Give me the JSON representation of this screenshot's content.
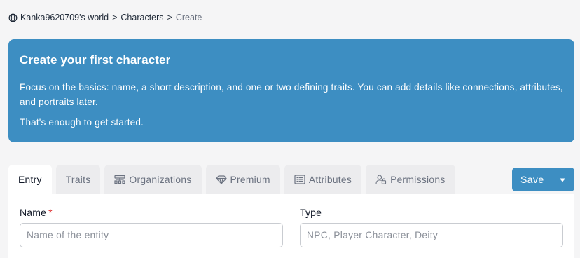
{
  "breadcrumb": {
    "world": "Kanka9620709's world",
    "separator": ">",
    "section": "Characters",
    "current": "Create"
  },
  "callout": {
    "title": "Create your first character",
    "body": "Focus on the basics: name, a short description, and one or two defining traits. You can add details like connections, attributes, and portraits later.",
    "footer": "That's enough to get started."
  },
  "tabs": [
    {
      "label": "Entry",
      "icon": "none",
      "active": true
    },
    {
      "label": "Traits",
      "icon": "none",
      "active": false
    },
    {
      "label": "Organizations",
      "icon": "organizations-icon",
      "active": false
    },
    {
      "label": "Premium",
      "icon": "gem-icon",
      "active": false
    },
    {
      "label": "Attributes",
      "icon": "list-icon",
      "active": false
    },
    {
      "label": "Permissions",
      "icon": "user-lock-icon",
      "active": false
    }
  ],
  "actions": {
    "save_label": "Save"
  },
  "form": {
    "name": {
      "label": "Name",
      "required_mark": "*",
      "placeholder": "Name of the entity",
      "value": ""
    },
    "type": {
      "label": "Type",
      "placeholder": "NPC, Player Character, Deity",
      "value": ""
    }
  },
  "colors": {
    "accent": "#3d8ec2",
    "page_bg": "#f5f5f6",
    "required": "#dc2626"
  }
}
